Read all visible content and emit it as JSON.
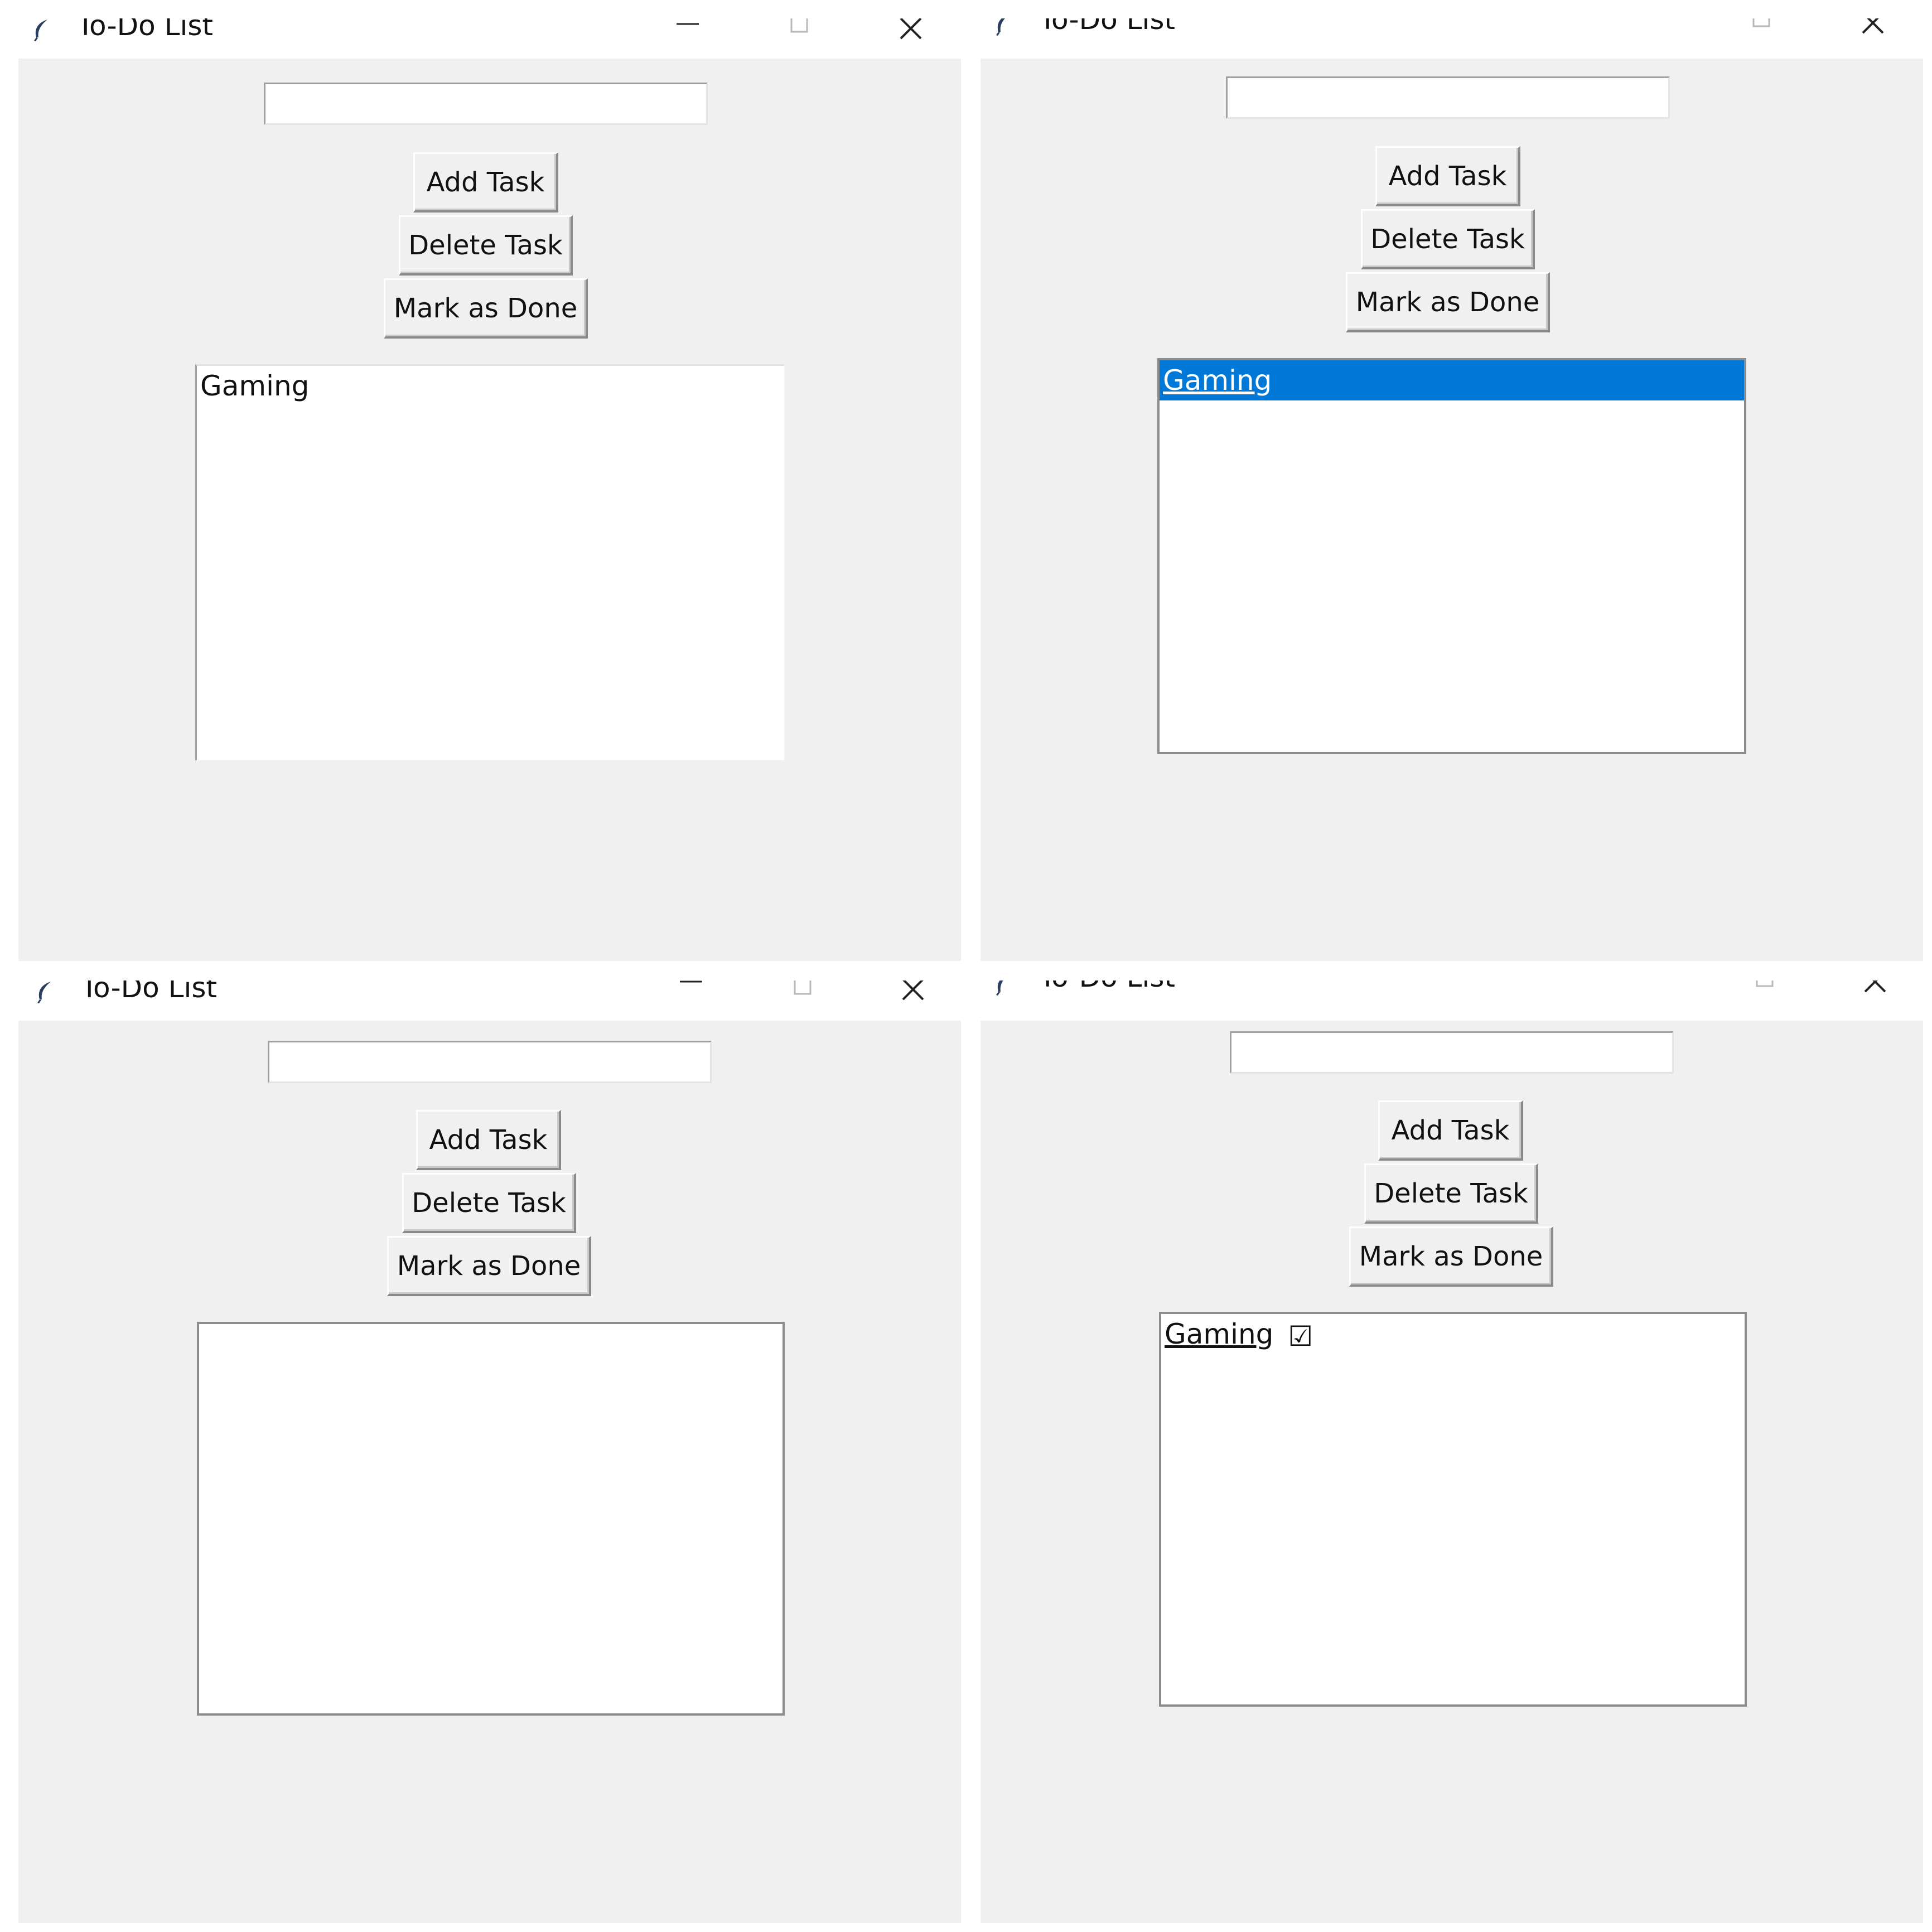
{
  "windows": [
    {
      "title": "To-Do List",
      "entry_value": "",
      "buttons": {
        "add": "Add Task",
        "delete": "Delete Task",
        "done": "Mark as Done"
      },
      "tasks": [
        {
          "text": "Gaming",
          "selected": false,
          "done_mark": ""
        }
      ]
    },
    {
      "title": "To-Do List",
      "entry_value": "",
      "buttons": {
        "add": "Add Task",
        "delete": "Delete Task",
        "done": "Mark as Done"
      },
      "tasks": [
        {
          "text": "Gaming",
          "selected": true,
          "done_mark": ""
        }
      ]
    },
    {
      "title": "To-Do List",
      "entry_value": "",
      "buttons": {
        "add": "Add Task",
        "delete": "Delete Task",
        "done": "Mark as Done"
      },
      "tasks": []
    },
    {
      "title": "To-Do List",
      "entry_value": "",
      "buttons": {
        "add": "Add Task",
        "delete": "Delete Task",
        "done": "Mark as Done"
      },
      "tasks": [
        {
          "text": "Gaming",
          "selected": false,
          "done_mark": "☑"
        }
      ]
    }
  ],
  "colors": {
    "window_bg": "#f0f0f0",
    "selection": "#0078d7",
    "listbox_bg": "#ffffff"
  },
  "icons": {
    "app": "feather-icon",
    "minimize": "minimize-icon",
    "maximize": "maximize-icon",
    "close": "close-icon"
  }
}
